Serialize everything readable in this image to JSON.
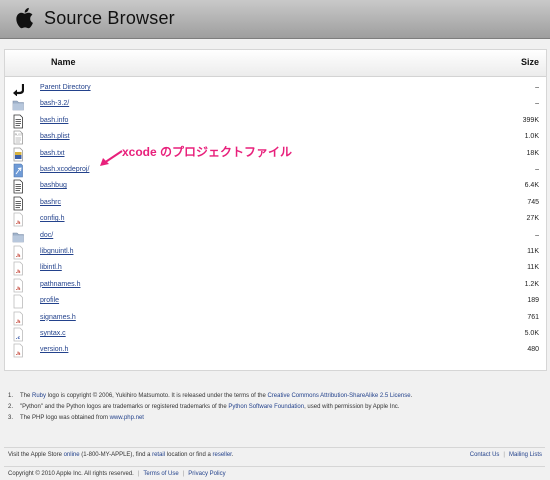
{
  "header": {
    "title": "Source Browser"
  },
  "table": {
    "col_name": "Name",
    "col_size": "Size",
    "rows": [
      {
        "name": "Parent Directory",
        "size": "–",
        "icon": "parent-directory-icon"
      },
      {
        "name": "bash-3.2/",
        "size": "–",
        "icon": "folder-icon"
      },
      {
        "name": "bash.info",
        "size": "399K",
        "icon": "text-file-icon"
      },
      {
        "name": "bash.plist",
        "size": "1.0K",
        "icon": "plist-file-icon"
      },
      {
        "name": "bash.txt",
        "size": "18K",
        "icon": "text-file-icon"
      },
      {
        "name": "bash.xcodeproj/",
        "size": "–",
        "icon": "xcode-project-icon"
      },
      {
        "name": "bashbug",
        "size": "6.4K",
        "icon": "text-file-icon"
      },
      {
        "name": "bashrc",
        "size": "745",
        "icon": "text-file-icon"
      },
      {
        "name": "config.h",
        "size": "27K",
        "icon": "header-file-icon"
      },
      {
        "name": "doc/",
        "size": "–",
        "icon": "folder-icon"
      },
      {
        "name": "libgnuintl.h",
        "size": "11K",
        "icon": "header-file-icon"
      },
      {
        "name": "libintl.h",
        "size": "11K",
        "icon": "header-file-icon"
      },
      {
        "name": "pathnames.h",
        "size": "1.2K",
        "icon": "header-file-icon"
      },
      {
        "name": "profile",
        "size": "189",
        "icon": "blank-file-icon"
      },
      {
        "name": "signames.h",
        "size": "761",
        "icon": "header-file-icon"
      },
      {
        "name": "syntax.c",
        "size": "5.0K",
        "icon": "c-file-icon"
      },
      {
        "name": "version.h",
        "size": "480",
        "icon": "header-file-icon"
      }
    ]
  },
  "annotation": {
    "text": "xcode のプロジェクトファイル",
    "color": "#e8207b"
  },
  "footnotes": [
    {
      "num": "1.",
      "pre": "The ",
      "link1": "Ruby",
      "mid": " logo is copyright © 2006, Yukihiro Matsumoto. It is released under the terms of the ",
      "link2": "Creative Commons Attribution-ShareAlike 2.5 License",
      "post": "."
    },
    {
      "num": "2.",
      "pre": "\"Python\" and the Python logos are trademarks or registered trademarks of the ",
      "link1": "Python Software Foundation",
      "mid": ", used with permission by Apple Inc.",
      "link2": "",
      "post": ""
    },
    {
      "num": "3.",
      "pre": "The PHP logo was obtained from ",
      "link1": "www.php.net",
      "mid": "",
      "link2": "",
      "post": ""
    }
  ],
  "footer": {
    "store_pre": "Visit the Apple Store ",
    "store_online": "online",
    "store_mid": " (1-800-MY-APPLE), find a ",
    "store_retail": "retail",
    "store_mid2": " location or find a ",
    "store_reseller": "reseller",
    "store_post": ".",
    "contact_us": "Contact Us",
    "mailing_lists": "Mailing Lists",
    "divider": "|",
    "copyright": "Copyright © 2010 Apple Inc. All rights reserved.",
    "terms": "Terms of Use",
    "privacy": "Privacy Policy"
  },
  "colors": {
    "link": "#23428c",
    "header_bg": "#b5b5b5",
    "page_bg": "#f1f1f1"
  }
}
